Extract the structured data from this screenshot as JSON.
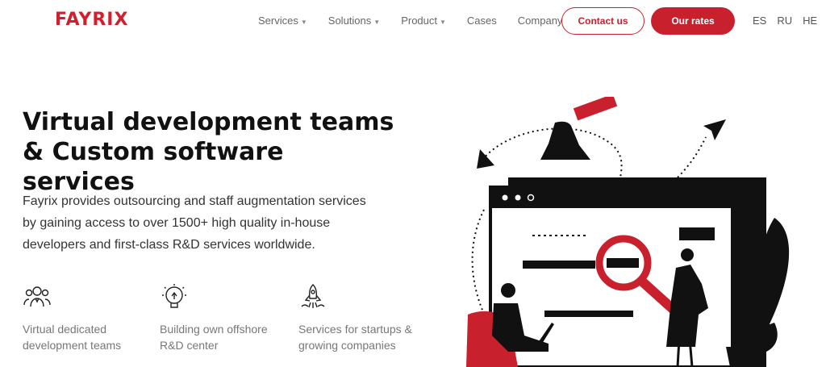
{
  "header": {
    "logo": "FAYRIX",
    "nav": [
      {
        "label": "Services",
        "has_caret": true
      },
      {
        "label": "Solutions",
        "has_caret": true
      },
      {
        "label": "Product",
        "has_caret": true
      },
      {
        "label": "Cases",
        "has_caret": false
      },
      {
        "label": "Company",
        "has_caret": true
      }
    ],
    "contact_label": "Contact us",
    "rates_label": "Our rates",
    "languages": [
      "ES",
      "RU",
      "HE"
    ]
  },
  "hero": {
    "title_line1": "Virtual development teams",
    "title_line2": "& Custom software services",
    "description": "Fayrix provides outsourcing and staff augmentation services by gaining access to over 1500+ high quality in-house developers and first-class R&D services worldwide."
  },
  "features": [
    {
      "icon": "team-icon",
      "line1": "Virtual dedicated",
      "line2": "development teams"
    },
    {
      "icon": "lightbulb-icon",
      "line1": "Building own offshore",
      "line2": "R&D center"
    },
    {
      "icon": "rocket-icon",
      "line1": "Services for startups &",
      "line2": "growing companies"
    }
  ],
  "colors": {
    "brand": "#c9202e",
    "text": "#111111",
    "muted": "#777777"
  }
}
